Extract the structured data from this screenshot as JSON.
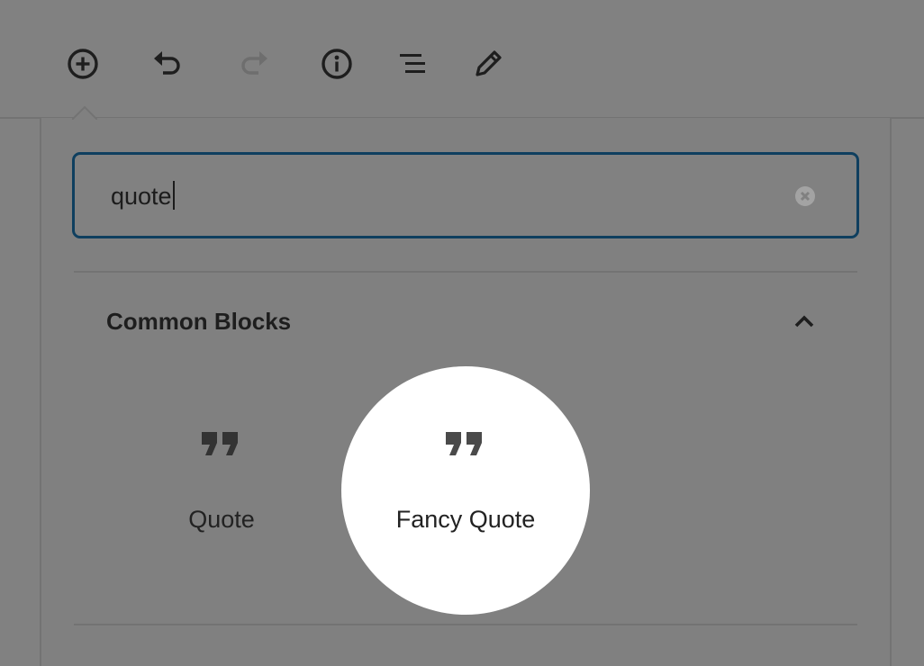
{
  "toolbar": {
    "buttons": [
      {
        "name": "add-block-icon"
      },
      {
        "name": "undo-icon"
      },
      {
        "name": "redo-icon"
      },
      {
        "name": "info-icon"
      },
      {
        "name": "block-navigation-icon"
      },
      {
        "name": "edit-icon"
      }
    ]
  },
  "inserter": {
    "search": {
      "value": "quote",
      "clear_icon": "clear-circle-icon"
    },
    "section": {
      "title": "Common Blocks",
      "toggle_icon": "chevron-up-icon",
      "expanded": true
    },
    "blocks": [
      {
        "label": "Quote",
        "icon": "quote-icon",
        "highlighted": false
      },
      {
        "label": "Fancy Quote",
        "icon": "quote-icon",
        "highlighted": true
      }
    ]
  },
  "colors": {
    "overlay_background": "#818181",
    "focus_border": "#0f3f5f",
    "highlight": "#ffffff",
    "text": "#1e1e1e",
    "icon": "#1e1e1e",
    "disabled_icon": "#6e6e6e"
  }
}
